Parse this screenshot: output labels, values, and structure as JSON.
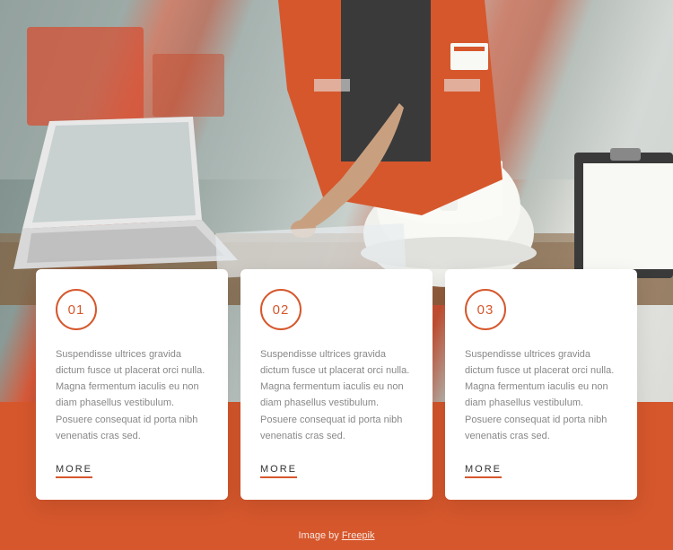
{
  "colors": {
    "accent": "#d6572c"
  },
  "cards": [
    {
      "num": "01",
      "text": "Suspendisse ultrices gravida dictum fusce ut placerat orci nulla. Magna fermentum iaculis eu non diam phasellus vestibulum. Posuere consequat id porta nibh venenatis cras sed.",
      "link": "MORE"
    },
    {
      "num": "02",
      "text": "Suspendisse ultrices gravida dictum fusce ut placerat orci nulla. Magna fermentum iaculis eu non diam phasellus vestibulum. Posuere consequat id porta nibh venenatis cras sed.",
      "link": "MORE"
    },
    {
      "num": "03",
      "text": "Suspendisse ultrices gravida dictum fusce ut placerat orci nulla. Magna fermentum iaculis eu non diam phasellus vestibulum. Posuere consequat id porta nibh venenatis cras sed.",
      "link": "MORE"
    }
  ],
  "attribution": {
    "prefix": "Image by ",
    "link": "Freepik"
  }
}
